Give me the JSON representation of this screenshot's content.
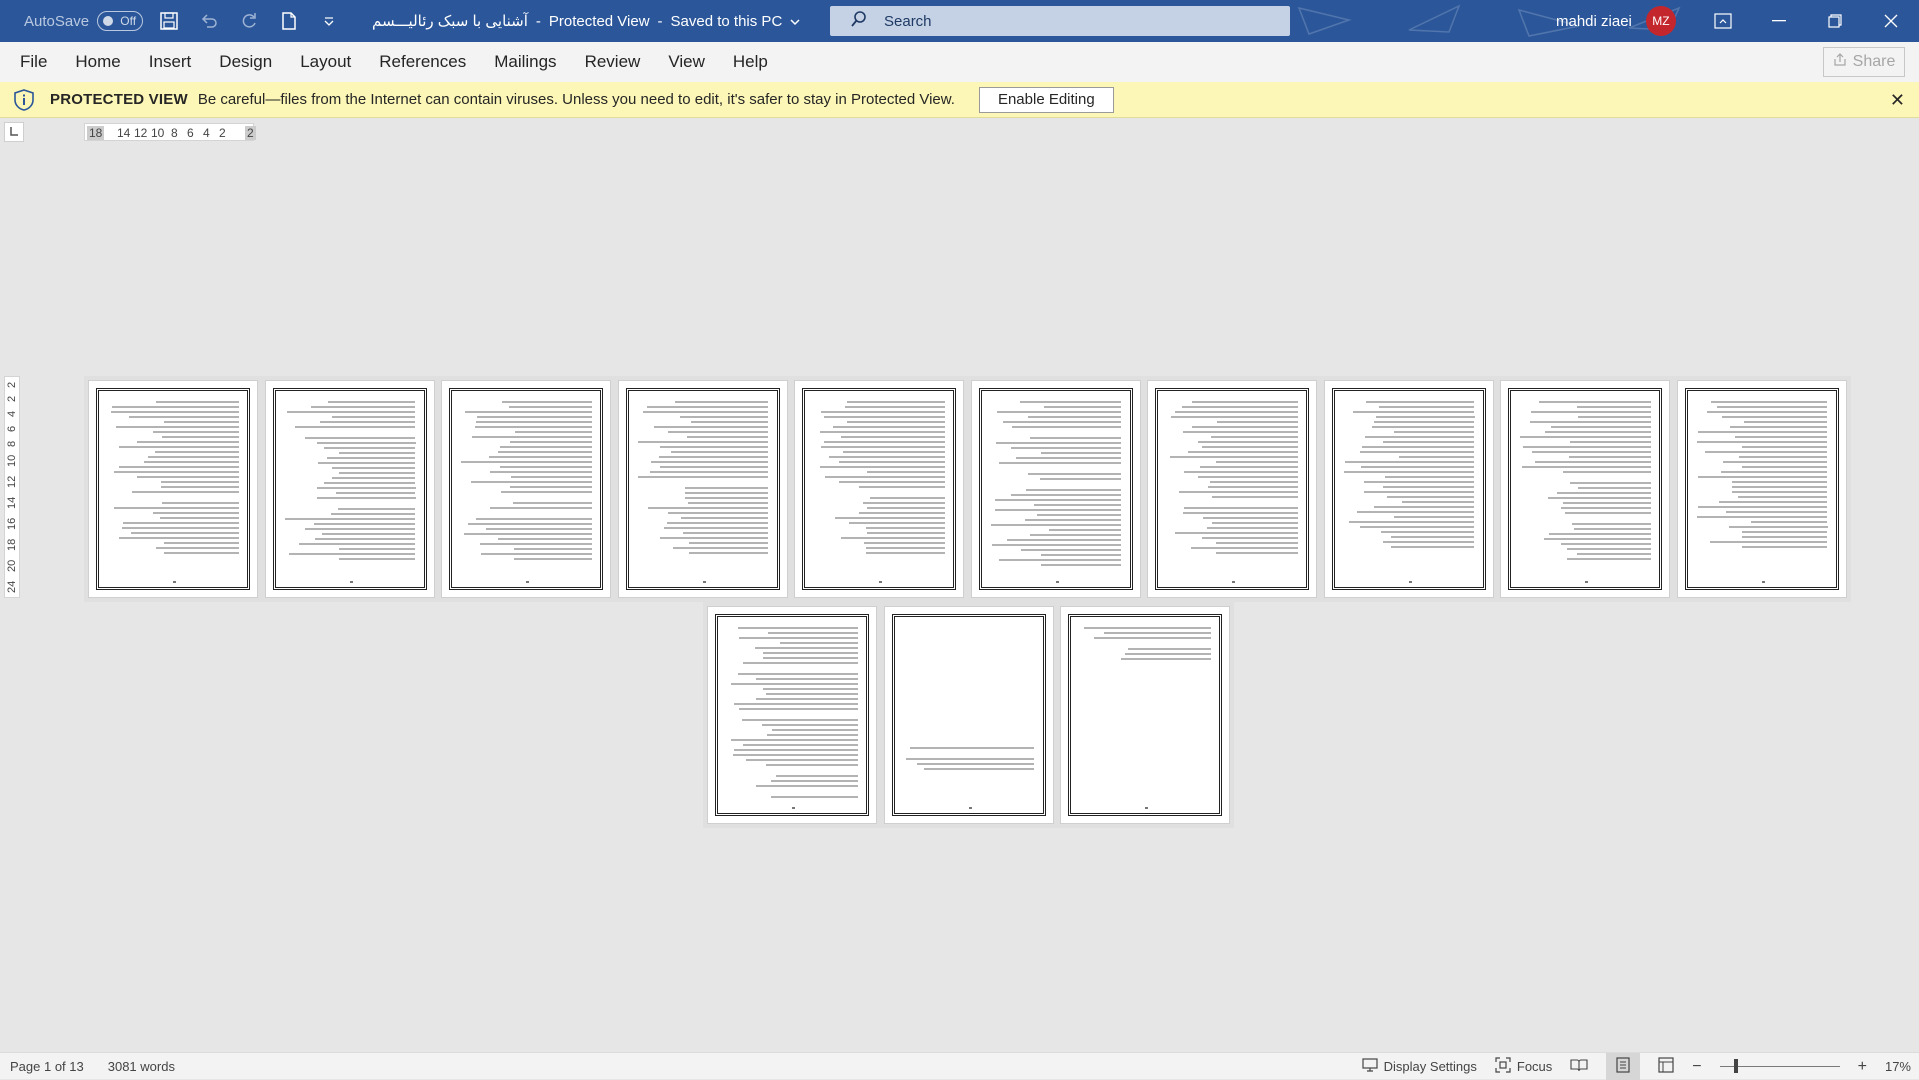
{
  "titlebar": {
    "autosave_label": "AutoSave",
    "autosave_state": "Off",
    "doc_name": "آشنایی با سبک رئالیـــسم",
    "separator": "-",
    "view_mode": "Protected View",
    "save_status": "Saved to this PC",
    "search_placeholder": "Search",
    "user_name": "mahdi ziaei",
    "user_initials": "MZ",
    "accent_color": "#2b579a"
  },
  "ribbon": {
    "tabs": [
      "File",
      "Home",
      "Insert",
      "Design",
      "Layout",
      "References",
      "Mailings",
      "Review",
      "View",
      "Help"
    ],
    "share_label": "Share"
  },
  "message_bar": {
    "title": "PROTECTED VIEW",
    "text": "Be careful—files from the Internet can contain viruses. Unless you need to edit, it's safer to stay in Protected View.",
    "button": "Enable Editing",
    "color": "#fcf7b6"
  },
  "ruler": {
    "horizontal": [
      "18",
      "14",
      "12",
      "10",
      "8",
      "6",
      "4",
      "2",
      "2"
    ],
    "vertical": [
      "2",
      "2",
      "4",
      "6",
      "8",
      "10",
      "12",
      "14",
      "16",
      "18",
      "20",
      "24"
    ]
  },
  "document": {
    "page_count": 13,
    "row1_pages": 10,
    "row2_pages": 3
  },
  "statusbar": {
    "page_info": "Page 1 of 13",
    "word_count": "3081 words",
    "display_settings": "Display Settings",
    "focus": "Focus",
    "zoom": "17%",
    "zoom_minus": "−",
    "zoom_plus": "+"
  }
}
